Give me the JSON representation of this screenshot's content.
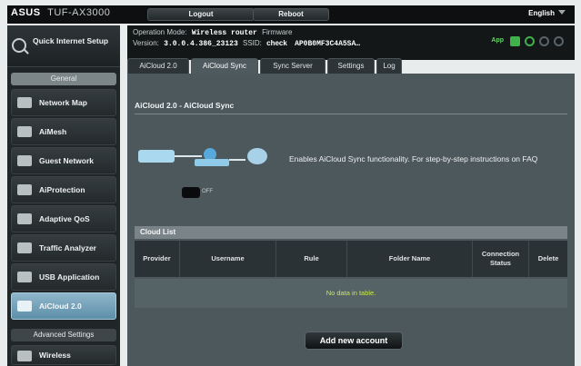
{
  "brand": {
    "logo": "ASUS",
    "model": "TUF-AX3000"
  },
  "topbar": {
    "logout_label": "Logout",
    "reboot_label": "Reboot",
    "language": "English"
  },
  "sidebar": {
    "quick_setup": "Quick Internet Setup",
    "general_header": "General",
    "items": [
      {
        "label": "Network Map",
        "icon": "network-map-icon"
      },
      {
        "label": "AiMesh",
        "icon": "aimesh-icon"
      },
      {
        "label": "Guest Network",
        "icon": "guest-network-icon"
      },
      {
        "label": "AiProtection",
        "icon": "shield-icon"
      },
      {
        "label": "Adaptive QoS",
        "icon": "qos-icon"
      },
      {
        "label": "Traffic Analyzer",
        "icon": "traffic-icon"
      },
      {
        "label": "USB Application",
        "icon": "usb-icon"
      },
      {
        "label": "AiCloud 2.0",
        "icon": "cloud-icon",
        "active": true
      }
    ],
    "advanced_header": "Advanced Settings",
    "advanced_items": [
      {
        "label": "Wireless",
        "icon": "wireless-icon"
      }
    ]
  },
  "status": {
    "op_mode_label": "Operation Mode:",
    "op_mode_value": "Wireless router",
    "firmware_label": "Firmware",
    "version_label": "Version:",
    "version_value": "3.0.0.4.386_23123",
    "ssid_label": "SSID:",
    "ssid_value": "check",
    "ssid_extra": "AP0B0MF3C4A5SA…",
    "app_label": "App",
    "icons": [
      "status-globe-icon",
      "status-usb-icon",
      "status-user-icon",
      "status-settings-icon"
    ]
  },
  "tabs": [
    {
      "label": "AiCloud 2.0"
    },
    {
      "label": "AiCloud Sync"
    },
    {
      "label": "Sync Server"
    },
    {
      "label": "Settings"
    },
    {
      "label": "Log"
    }
  ],
  "main": {
    "page_title": "AiCloud 2.0 - AiCloud Sync",
    "description": "Enables AiCloud Sync functionality. For step-by-step instructions on FAQ",
    "toggle_label": "OFF",
    "table_title": "Cloud List",
    "columns": [
      "Provider",
      "Username",
      "Rule",
      "Folder Name",
      "Connection Status",
      "Delete"
    ],
    "empty_text": "No data in table.",
    "add_button": "Add new account"
  }
}
